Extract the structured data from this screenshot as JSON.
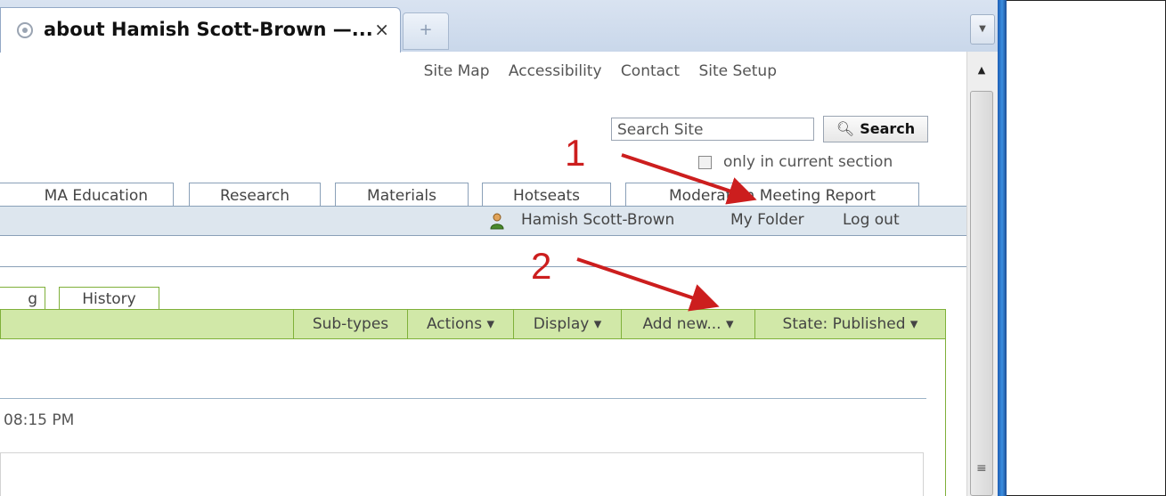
{
  "browser": {
    "tab_title": "about Hamish Scott-Brown —...",
    "tab_close": "×",
    "new_tab": "+"
  },
  "site_actions": [
    "Site Map",
    "Accessibility",
    "Contact",
    "Site Setup"
  ],
  "search": {
    "placeholder": "Search Site",
    "button_label": "Search",
    "current_section_label": "only in current section"
  },
  "nav_tabs": [
    "MA Education",
    "Research",
    "Materials",
    "Hotseats",
    "Moderation Meeting Report"
  ],
  "personal_bar": {
    "user": "Hamish Scott-Brown",
    "my_folder": "My Folder",
    "logout": "Log out"
  },
  "content_tabs": [
    "g",
    "History"
  ],
  "content_actions": [
    "Sub-types",
    "Actions ▾",
    "Display ▾",
    "Add new... ▾",
    "State: Published ▾"
  ],
  "document": {
    "timestamp": "08:15 PM"
  },
  "annotations": [
    "1",
    "2"
  ],
  "colors": {
    "annotation": "#cc1e1e",
    "action_bar": "#d1e8a8",
    "portal_bar": "#dde6ee"
  }
}
